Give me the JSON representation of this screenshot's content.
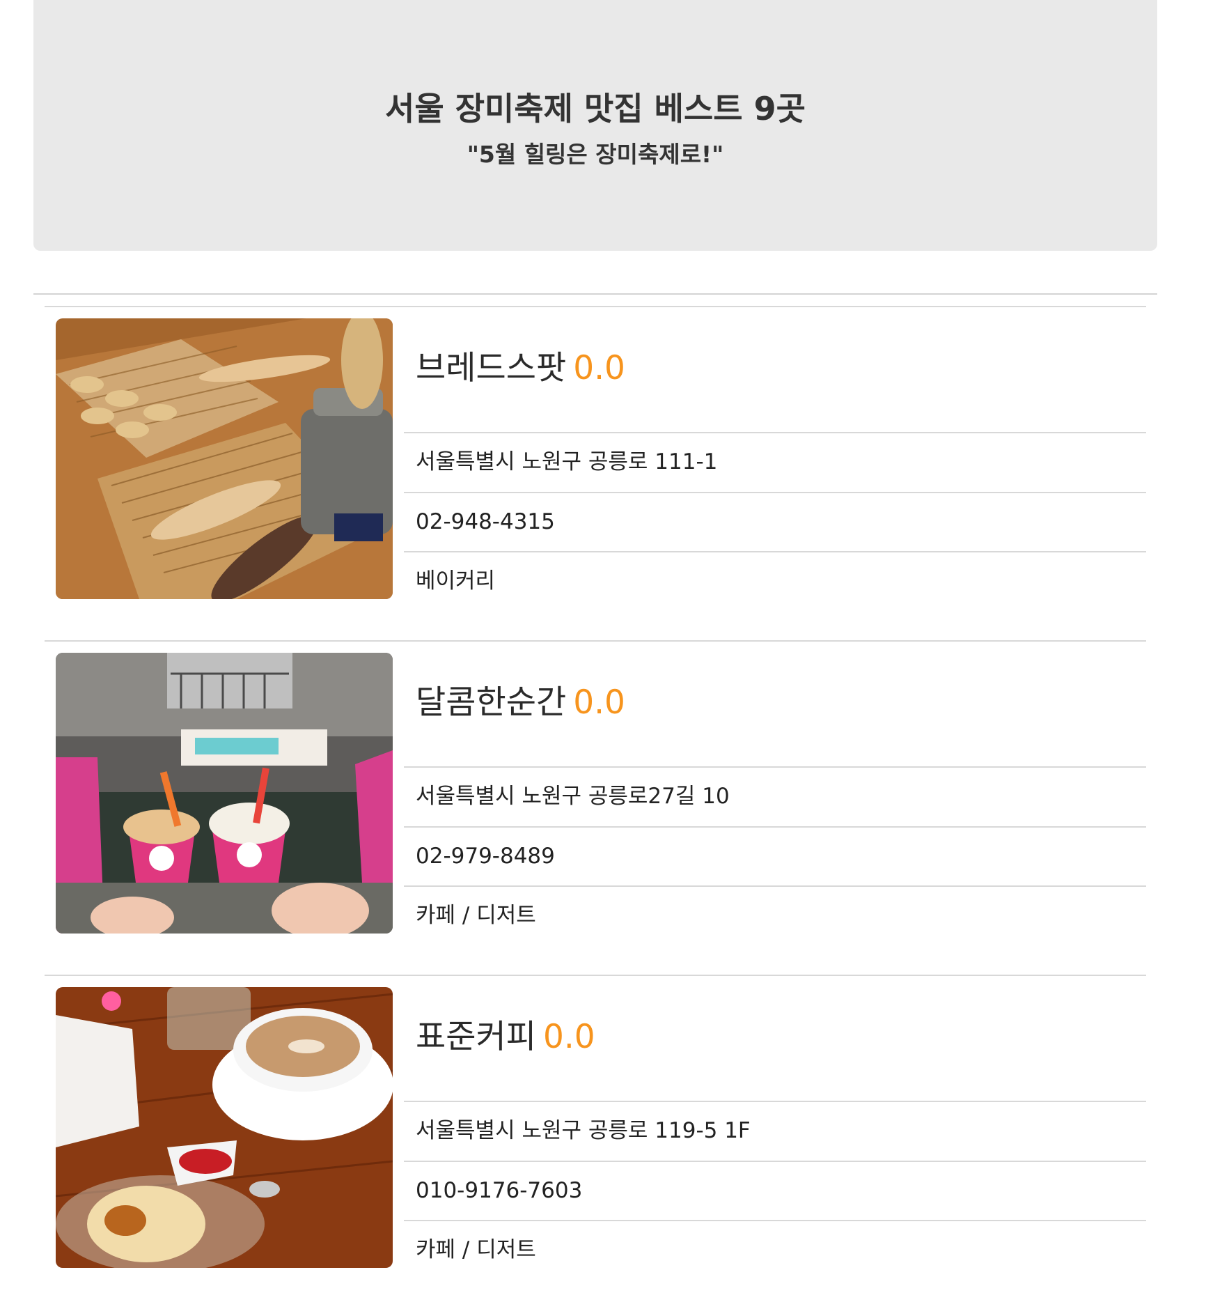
{
  "header": {
    "title": "서울 장미축제 맛집 베스트 9곳",
    "subtitle": "\"5월 힐링은 장미축제로!\""
  },
  "restaurants": [
    {
      "name": "브레드스팟",
      "rating": "0.0",
      "address": "서울특별시 노원구 공릉로 111-1",
      "phone": "02-948-4315",
      "category": "베이커리"
    },
    {
      "name": "달콤한순간",
      "rating": "0.0",
      "address": "서울특별시 노원구 공릉로27길 10",
      "phone": "02-979-8489",
      "category": "카페 / 디저트"
    },
    {
      "name": "표준커피",
      "rating": "0.0",
      "address": "서울특별시 노원구 공릉로 119-5 1F",
      "phone": "010-9176-7603",
      "category": "카페 / 디저트"
    }
  ],
  "colors": {
    "rating_accent": "#f7941d",
    "hero_background": "#e9e9e9",
    "divider": "#d8d8d8"
  }
}
